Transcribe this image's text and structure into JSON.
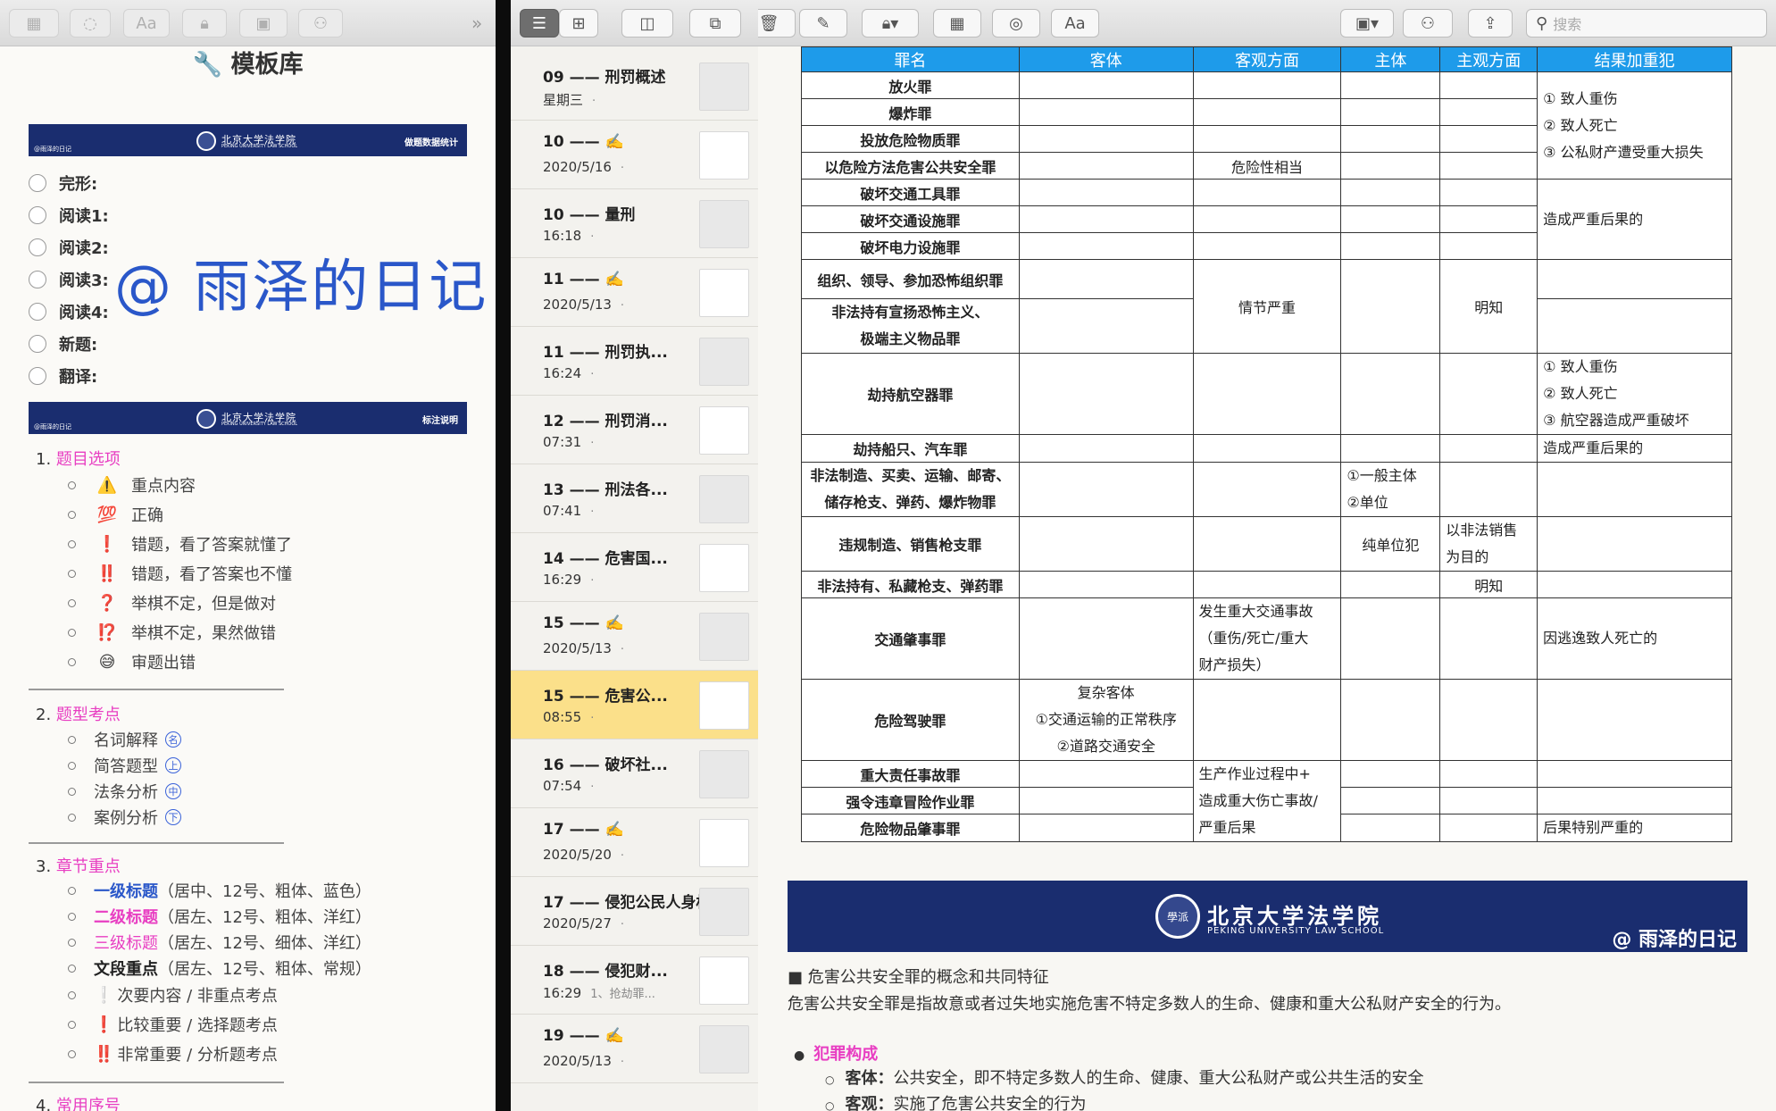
{
  "left": {
    "title": "🔧 模板库",
    "banner1": {
      "school": "北京大学法学院",
      "school_en": "PEKING UNIVERSITY LAW SCHOOL",
      "left": "@雨泽的日记",
      "right": "做题数据统计"
    },
    "checks": [
      "完形:",
      "阅读1:",
      "阅读2:",
      "阅读3:",
      "阅读4:",
      "新题:",
      "翻译:"
    ],
    "watermark": "@ 雨泽的日记",
    "banner2": {
      "school": "北京大学法学院",
      "school_en": "PEKING UNIVERSITY LAW SCHOOL",
      "left": "@雨泽的日记",
      "right": "标注说明"
    },
    "sec1": {
      "num": "1.",
      "title": "题目选项"
    },
    "sec1_items": [
      {
        "icon": "⚠️",
        "text": "重点内容"
      },
      {
        "icon": "💯",
        "text": "正确"
      },
      {
        "icon": "❗",
        "text": "错题，看了答案就懂了"
      },
      {
        "icon": "‼️",
        "text": "错题，看了答案也不懂"
      },
      {
        "icon": "❓",
        "text": "举棋不定，但是做对"
      },
      {
        "icon": "⁉️",
        "text": "举棋不定，果然做错"
      },
      {
        "icon": "😅",
        "text": "审题出错"
      }
    ],
    "sec2": {
      "num": "2.",
      "title": "题型考点"
    },
    "sec2_items": [
      {
        "text": "名词解释",
        "mark": "名"
      },
      {
        "text": "简答题型",
        "mark": "上"
      },
      {
        "text": "法条分析",
        "mark": "中"
      },
      {
        "text": "案例分析",
        "mark": "下"
      }
    ],
    "sec3": {
      "num": "3.",
      "title": "章节重点"
    },
    "sec3_items": [
      {
        "key": "一级标题",
        "desc": "（居中、12号、粗体、蓝色）"
      },
      {
        "key": "二级标题",
        "desc": "（居左、12号、粗体、洋红）"
      },
      {
        "key": "三级标题",
        "desc": "（居左、12号、细体、洋红）"
      },
      {
        "key": "文段重点",
        "desc": "（居左、12号、粗体、常规）"
      }
    ],
    "sec3_marks": [
      {
        "icon": "❕",
        "text": "次要内容 / 非重点考点"
      },
      {
        "icon": "❗",
        "text": "比较重要 / 选择题考点"
      },
      {
        "icon": "‼️",
        "text": "非常重要 / 分析题考点"
      }
    ],
    "sec4": {
      "num": "4.",
      "title": "常用序号"
    }
  },
  "notes": [
    {
      "title": "09 —— 刑罚概述",
      "date": "星期三",
      "dot": "·"
    },
    {
      "title": "10 —— ✍️",
      "date": "2020/5/16",
      "dot": "·"
    },
    {
      "title": "10 —— 量刑",
      "date": "16:18",
      "dot": "·"
    },
    {
      "title": "11 —— ✍️",
      "date": "2020/5/13",
      "dot": "·"
    },
    {
      "title": "11 —— 刑罚执...",
      "date": "16:24",
      "dot": "·"
    },
    {
      "title": "12 —— 刑罚消...",
      "date": "07:31",
      "dot": "·"
    },
    {
      "title": "13 —— 刑法各...",
      "date": "07:41",
      "dot": "·"
    },
    {
      "title": "14 —— 危害国...",
      "date": "16:29",
      "dot": "·"
    },
    {
      "title": "15 —— ✍️",
      "date": "2020/5/13",
      "dot": "·"
    },
    {
      "title": "15 —— 危害公...",
      "date": "08:55",
      "dot": "·"
    },
    {
      "title": "16 —— 破坏社...",
      "date": "07:54",
      "dot": "·"
    },
    {
      "title": "17 —— ✍️",
      "date": "2020/5/20",
      "dot": "·"
    },
    {
      "title": "17 —— 侵犯公民人身权...",
      "date": "2020/5/27",
      "dot": "·"
    },
    {
      "title": "18 —— 侵犯财...",
      "date": "16:29",
      "dot": "1、抢劫罪..."
    },
    {
      "title": "19 —— ✍️",
      "date": "2020/5/13",
      "dot": "·"
    }
  ],
  "toolbar": {
    "search_placeholder": "搜索",
    "font_label": "Aa"
  },
  "table": {
    "headers": [
      "罪名",
      "客体",
      "客观方面",
      "主体",
      "主观方面",
      "结果加重犯"
    ],
    "crimes": [
      "放火罪",
      "爆炸罪",
      "投放危险物质罪",
      "以危险方法危害公共安全罪",
      "破坏交通工具罪",
      "破坏交通设施罪",
      "破坏电力设施罪",
      "组织、领导、参加恐怖组织罪",
      "非法持有宣扬恐怖主义、",
      "极端主义物品罪",
      "劫持航空器罪",
      "劫持船只、汽车罪",
      "非法制造、买卖、运输、邮寄、",
      "储存枪支、弹药、爆炸物罪",
      "违规制造、销售枪支罪",
      "非法持有、私藏枪支、弹药罪",
      "交通肇事罪",
      "危险驾驶罪",
      "重大责任事故罪",
      "强令违章冒险作业罪",
      "危险物品肇事罪"
    ],
    "c_danger": "危险性相当",
    "c_serious": "情节严重",
    "c_traffic": [
      "发生重大交通事故",
      "（重伤/死亡/重大",
      "财产损失）"
    ],
    "c_work": [
      "生产作业过程中+",
      "造成重大伤亡事故/",
      "严重后果"
    ],
    "obj_complex": [
      "复杂客体",
      "①交通运输的正常秩序",
      "②道路交通安全"
    ],
    "subj_gun": [
      "①一般主体",
      "②单位"
    ],
    "subj_unit": "纯单位犯",
    "mind_know": "明知",
    "mind_sell": [
      "以非法销售",
      "为目的"
    ],
    "mind_know2": "明知",
    "r_fire": [
      "① 致人重伤",
      "② 致人死亡",
      "③ 公私财产遭受重大损失"
    ],
    "r_serious": "造成严重后果的",
    "r_air": [
      "① 致人重伤",
      "② 致人死亡",
      "③ 航空器造成严重破坏"
    ],
    "r_ship": "造成严重后果的",
    "r_traffic": "因逃逸致人死亡的",
    "r_danger": "后果特别严重的"
  },
  "lower": {
    "school": "北京大学法学院",
    "school_en": "PEKING UNIVERSITY LAW SCHOOL",
    "seal": "學派",
    "at": "@ 雨泽的日记",
    "h1": "■ 危害公共安全罪的概念和共同特征",
    "p1": "危害公共安全罪是指故意或者过失地实施危害不特定多数人的生命、健康和重大公私财产安全的行为。",
    "h2": "犯罪构成",
    "i1_key": "客体：",
    "i1_text": "公共安全，即不特定多数人的生命、健康、重大公私财产或公共生活的安全",
    "i2_key": "客观：",
    "i2_text": "实施了危害公共安全的行为"
  },
  "colors": {
    "pink": "#e83ec2",
    "blue": "#2a57c9",
    "header_blue": "#1e9bea",
    "navy": "#1a2d6f",
    "selected": "#fbe08a"
  }
}
